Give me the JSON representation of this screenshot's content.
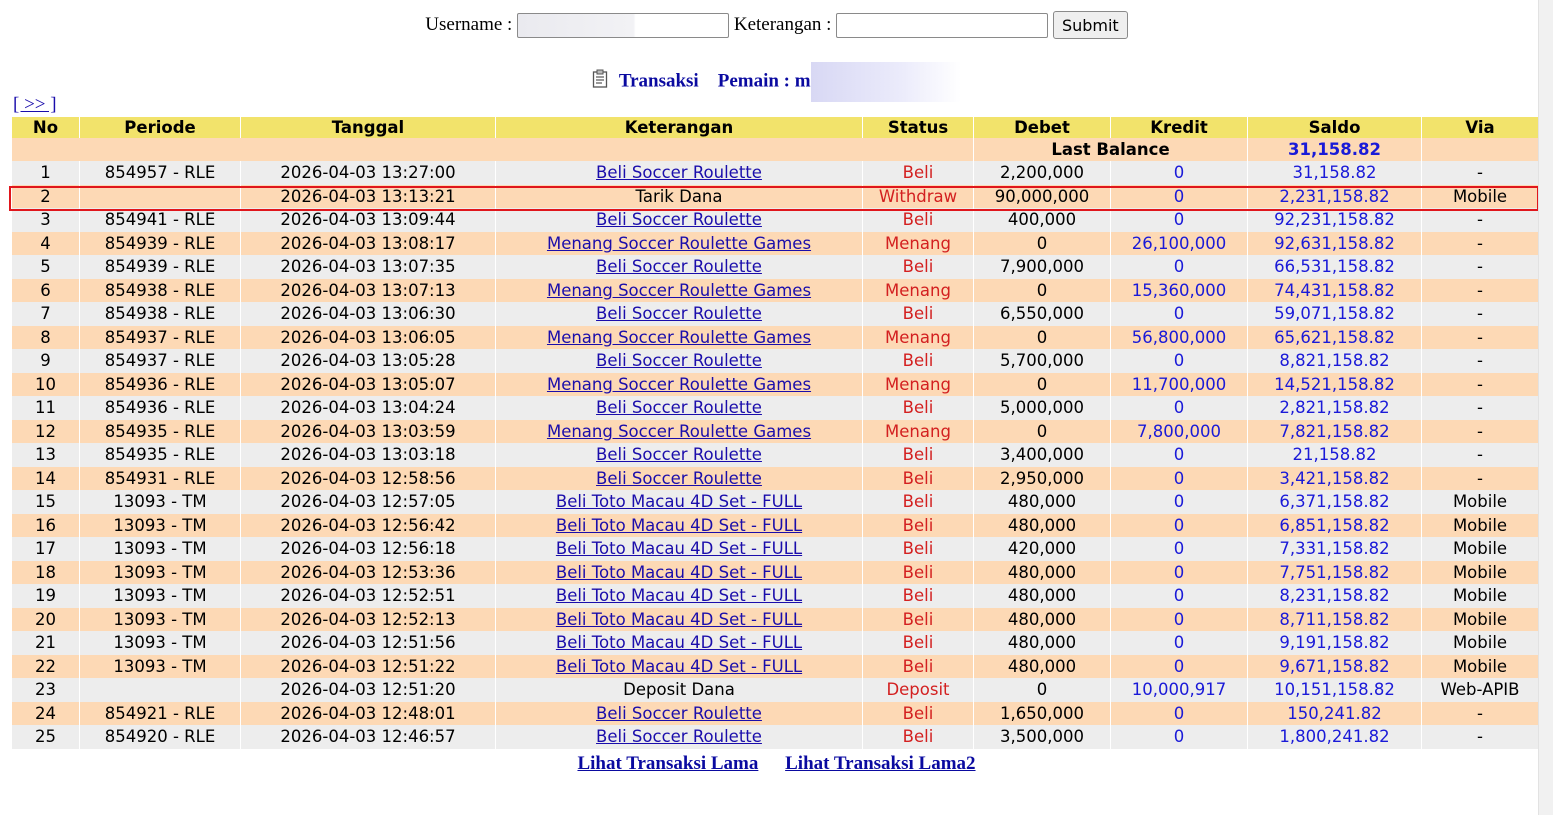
{
  "form": {
    "username_label": "Username :",
    "keterangan_label": "Keterangan :",
    "submit_label": "Submit"
  },
  "header": {
    "transaksi": "Transaksi",
    "pemain_label": "Pemain :",
    "pemain_visible": "m"
  },
  "nav": {
    "next": "[ >> ]"
  },
  "table": {
    "columns": [
      "No",
      "Periode",
      "Tanggal",
      "Keterangan",
      "Status",
      "Debet",
      "Kredit",
      "Saldo",
      "Via"
    ],
    "last_balance_label": "Last Balance",
    "last_balance_value": "31,158.82",
    "rows": [
      {
        "no": "1",
        "periode": "854957 - RLE",
        "tanggal": "2026-04-03 13:27:00",
        "ket": "Beli Soccer Roulette",
        "link": true,
        "status": "Beli",
        "debet": "2,200,000",
        "kredit": "0",
        "saldo": "31,158.82",
        "via": "-"
      },
      {
        "no": "2",
        "periode": "",
        "tanggal": "2026-04-03 13:13:21",
        "ket": "Tarik Dana",
        "link": false,
        "status": "Withdraw",
        "debet": "90,000,000",
        "kredit": "0",
        "saldo": "2,231,158.82",
        "via": "Mobile"
      },
      {
        "no": "3",
        "periode": "854941 - RLE",
        "tanggal": "2026-04-03 13:09:44",
        "ket": "Beli Soccer Roulette",
        "link": true,
        "status": "Beli",
        "debet": "400,000",
        "kredit": "0",
        "saldo": "92,231,158.82",
        "via": "-"
      },
      {
        "no": "4",
        "periode": "854939 - RLE",
        "tanggal": "2026-04-03 13:08:17",
        "ket": "Menang Soccer Roulette Games",
        "link": true,
        "status": "Menang",
        "debet": "0",
        "kredit": "26,100,000",
        "saldo": "92,631,158.82",
        "via": "-"
      },
      {
        "no": "5",
        "periode": "854939 - RLE",
        "tanggal": "2026-04-03 13:07:35",
        "ket": "Beli Soccer Roulette",
        "link": true,
        "status": "Beli",
        "debet": "7,900,000",
        "kredit": "0",
        "saldo": "66,531,158.82",
        "via": "-"
      },
      {
        "no": "6",
        "periode": "854938 - RLE",
        "tanggal": "2026-04-03 13:07:13",
        "ket": "Menang Soccer Roulette Games",
        "link": true,
        "status": "Menang",
        "debet": "0",
        "kredit": "15,360,000",
        "saldo": "74,431,158.82",
        "via": "-"
      },
      {
        "no": "7",
        "periode": "854938 - RLE",
        "tanggal": "2026-04-03 13:06:30",
        "ket": "Beli Soccer Roulette",
        "link": true,
        "status": "Beli",
        "debet": "6,550,000",
        "kredit": "0",
        "saldo": "59,071,158.82",
        "via": "-"
      },
      {
        "no": "8",
        "periode": "854937 - RLE",
        "tanggal": "2026-04-03 13:06:05",
        "ket": "Menang Soccer Roulette Games",
        "link": true,
        "status": "Menang",
        "debet": "0",
        "kredit": "56,800,000",
        "saldo": "65,621,158.82",
        "via": "-"
      },
      {
        "no": "9",
        "periode": "854937 - RLE",
        "tanggal": "2026-04-03 13:05:28",
        "ket": "Beli Soccer Roulette",
        "link": true,
        "status": "Beli",
        "debet": "5,700,000",
        "kredit": "0",
        "saldo": "8,821,158.82",
        "via": "-"
      },
      {
        "no": "10",
        "periode": "854936 - RLE",
        "tanggal": "2026-04-03 13:05:07",
        "ket": "Menang Soccer Roulette Games",
        "link": true,
        "status": "Menang",
        "debet": "0",
        "kredit": "11,700,000",
        "saldo": "14,521,158.82",
        "via": "-"
      },
      {
        "no": "11",
        "periode": "854936 - RLE",
        "tanggal": "2026-04-03 13:04:24",
        "ket": "Beli Soccer Roulette",
        "link": true,
        "status": "Beli",
        "debet": "5,000,000",
        "kredit": "0",
        "saldo": "2,821,158.82",
        "via": "-"
      },
      {
        "no": "12",
        "periode": "854935 - RLE",
        "tanggal": "2026-04-03 13:03:59",
        "ket": "Menang Soccer Roulette Games",
        "link": true,
        "status": "Menang",
        "debet": "0",
        "kredit": "7,800,000",
        "saldo": "7,821,158.82",
        "via": "-"
      },
      {
        "no": "13",
        "periode": "854935 - RLE",
        "tanggal": "2026-04-03 13:03:18",
        "ket": "Beli Soccer Roulette",
        "link": true,
        "status": "Beli",
        "debet": "3,400,000",
        "kredit": "0",
        "saldo": "21,158.82",
        "via": "-"
      },
      {
        "no": "14",
        "periode": "854931 - RLE",
        "tanggal": "2026-04-03 12:58:56",
        "ket": "Beli Soccer Roulette",
        "link": true,
        "status": "Beli",
        "debet": "2,950,000",
        "kredit": "0",
        "saldo": "3,421,158.82",
        "via": "-"
      },
      {
        "no": "15",
        "periode": "13093 - TM",
        "tanggal": "2026-04-03 12:57:05",
        "ket": "Beli Toto Macau 4D Set - FULL",
        "link": true,
        "status": "Beli",
        "debet": "480,000",
        "kredit": "0",
        "saldo": "6,371,158.82",
        "via": "Mobile"
      },
      {
        "no": "16",
        "periode": "13093 - TM",
        "tanggal": "2026-04-03 12:56:42",
        "ket": "Beli Toto Macau 4D Set - FULL",
        "link": true,
        "status": "Beli",
        "debet": "480,000",
        "kredit": "0",
        "saldo": "6,851,158.82",
        "via": "Mobile"
      },
      {
        "no": "17",
        "periode": "13093 - TM",
        "tanggal": "2026-04-03 12:56:18",
        "ket": "Beli Toto Macau 4D Set - FULL",
        "link": true,
        "status": "Beli",
        "debet": "420,000",
        "kredit": "0",
        "saldo": "7,331,158.82",
        "via": "Mobile"
      },
      {
        "no": "18",
        "periode": "13093 - TM",
        "tanggal": "2026-04-03 12:53:36",
        "ket": "Beli Toto Macau 4D Set - FULL",
        "link": true,
        "status": "Beli",
        "debet": "480,000",
        "kredit": "0",
        "saldo": "7,751,158.82",
        "via": "Mobile"
      },
      {
        "no": "19",
        "periode": "13093 - TM",
        "tanggal": "2026-04-03 12:52:51",
        "ket": "Beli Toto Macau 4D Set - FULL",
        "link": true,
        "status": "Beli",
        "debet": "480,000",
        "kredit": "0",
        "saldo": "8,231,158.82",
        "via": "Mobile"
      },
      {
        "no": "20",
        "periode": "13093 - TM",
        "tanggal": "2026-04-03 12:52:13",
        "ket": "Beli Toto Macau 4D Set - FULL",
        "link": true,
        "status": "Beli",
        "debet": "480,000",
        "kredit": "0",
        "saldo": "8,711,158.82",
        "via": "Mobile"
      },
      {
        "no": "21",
        "periode": "13093 - TM",
        "tanggal": "2026-04-03 12:51:56",
        "ket": "Beli Toto Macau 4D Set - FULL",
        "link": true,
        "status": "Beli",
        "debet": "480,000",
        "kredit": "0",
        "saldo": "9,191,158.82",
        "via": "Mobile"
      },
      {
        "no": "22",
        "periode": "13093 - TM",
        "tanggal": "2026-04-03 12:51:22",
        "ket": "Beli Toto Macau 4D Set - FULL",
        "link": true,
        "status": "Beli",
        "debet": "480,000",
        "kredit": "0",
        "saldo": "9,671,158.82",
        "via": "Mobile"
      },
      {
        "no": "23",
        "periode": "",
        "tanggal": "2026-04-03 12:51:20",
        "ket": "Deposit Dana",
        "link": false,
        "status": "Deposit",
        "debet": "0",
        "kredit": "10,000,917",
        "saldo": "10,151,158.82",
        "via": "Web-APIB"
      },
      {
        "no": "24",
        "periode": "854921 - RLE",
        "tanggal": "2026-04-03 12:48:01",
        "ket": "Beli Soccer Roulette",
        "link": true,
        "status": "Beli",
        "debet": "1,650,000",
        "kredit": "0",
        "saldo": "150,241.82",
        "via": "-"
      },
      {
        "no": "25",
        "periode": "854920 - RLE",
        "tanggal": "2026-04-03 12:46:57",
        "ket": "Beli Soccer Roulette",
        "link": true,
        "status": "Beli",
        "debet": "3,500,000",
        "kredit": "0",
        "saldo": "1,800,241.82",
        "via": "-"
      }
    ]
  },
  "footer": {
    "link1": "Lihat Transaksi Lama",
    "link2": "Lihat Transaksi Lama2"
  },
  "colors": {
    "header_bg": "#f2e36b",
    "row_orange": "#fdd9b5",
    "row_gray": "#ededed",
    "status_red": "#d32020",
    "value_blue": "#1a1ad8",
    "highlight_border": "#e0161c"
  }
}
